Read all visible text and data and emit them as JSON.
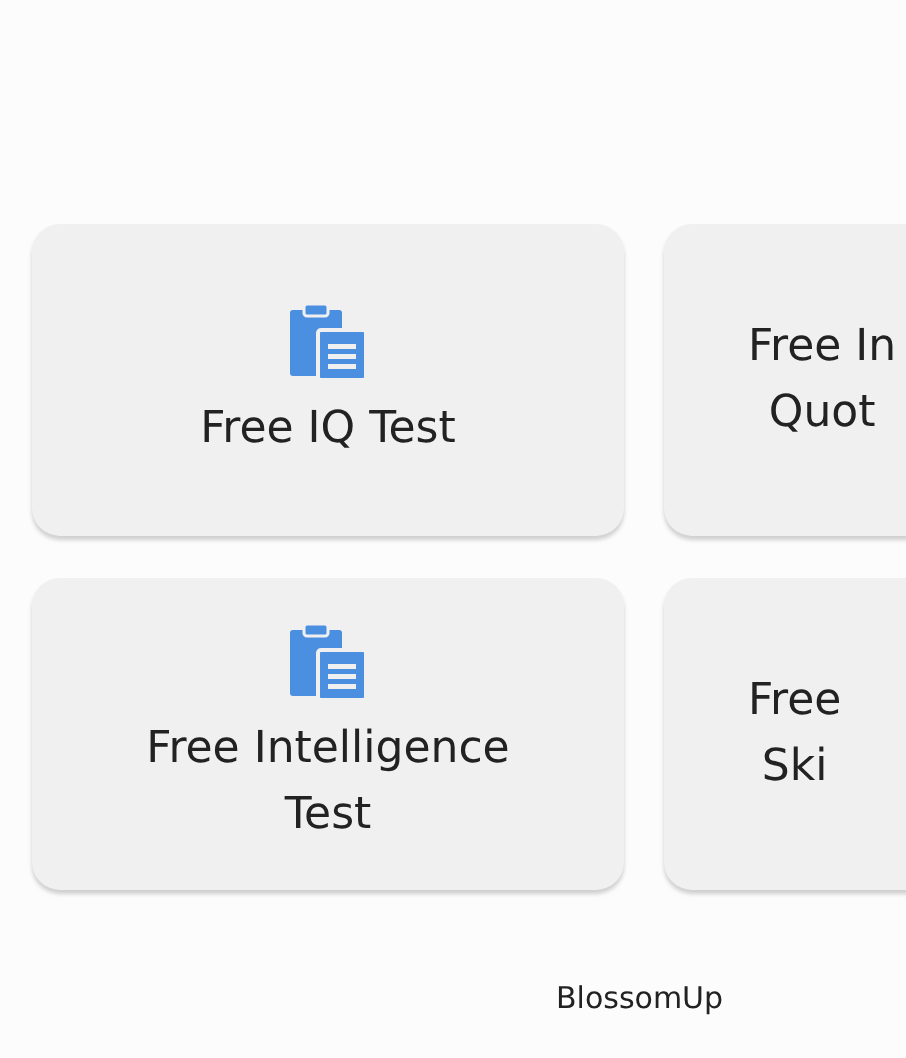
{
  "cards": [
    {
      "has_icon": true,
      "lines": [
        "Free IQ Test"
      ]
    },
    {
      "has_icon": false,
      "lines": [
        "Free In",
        "Quot"
      ]
    },
    {
      "has_icon": true,
      "lines": [
        "Free Intelligence",
        "Test"
      ]
    },
    {
      "has_icon": false,
      "lines": [
        "Free",
        "Ski"
      ]
    }
  ],
  "footer": "BlossomUp"
}
